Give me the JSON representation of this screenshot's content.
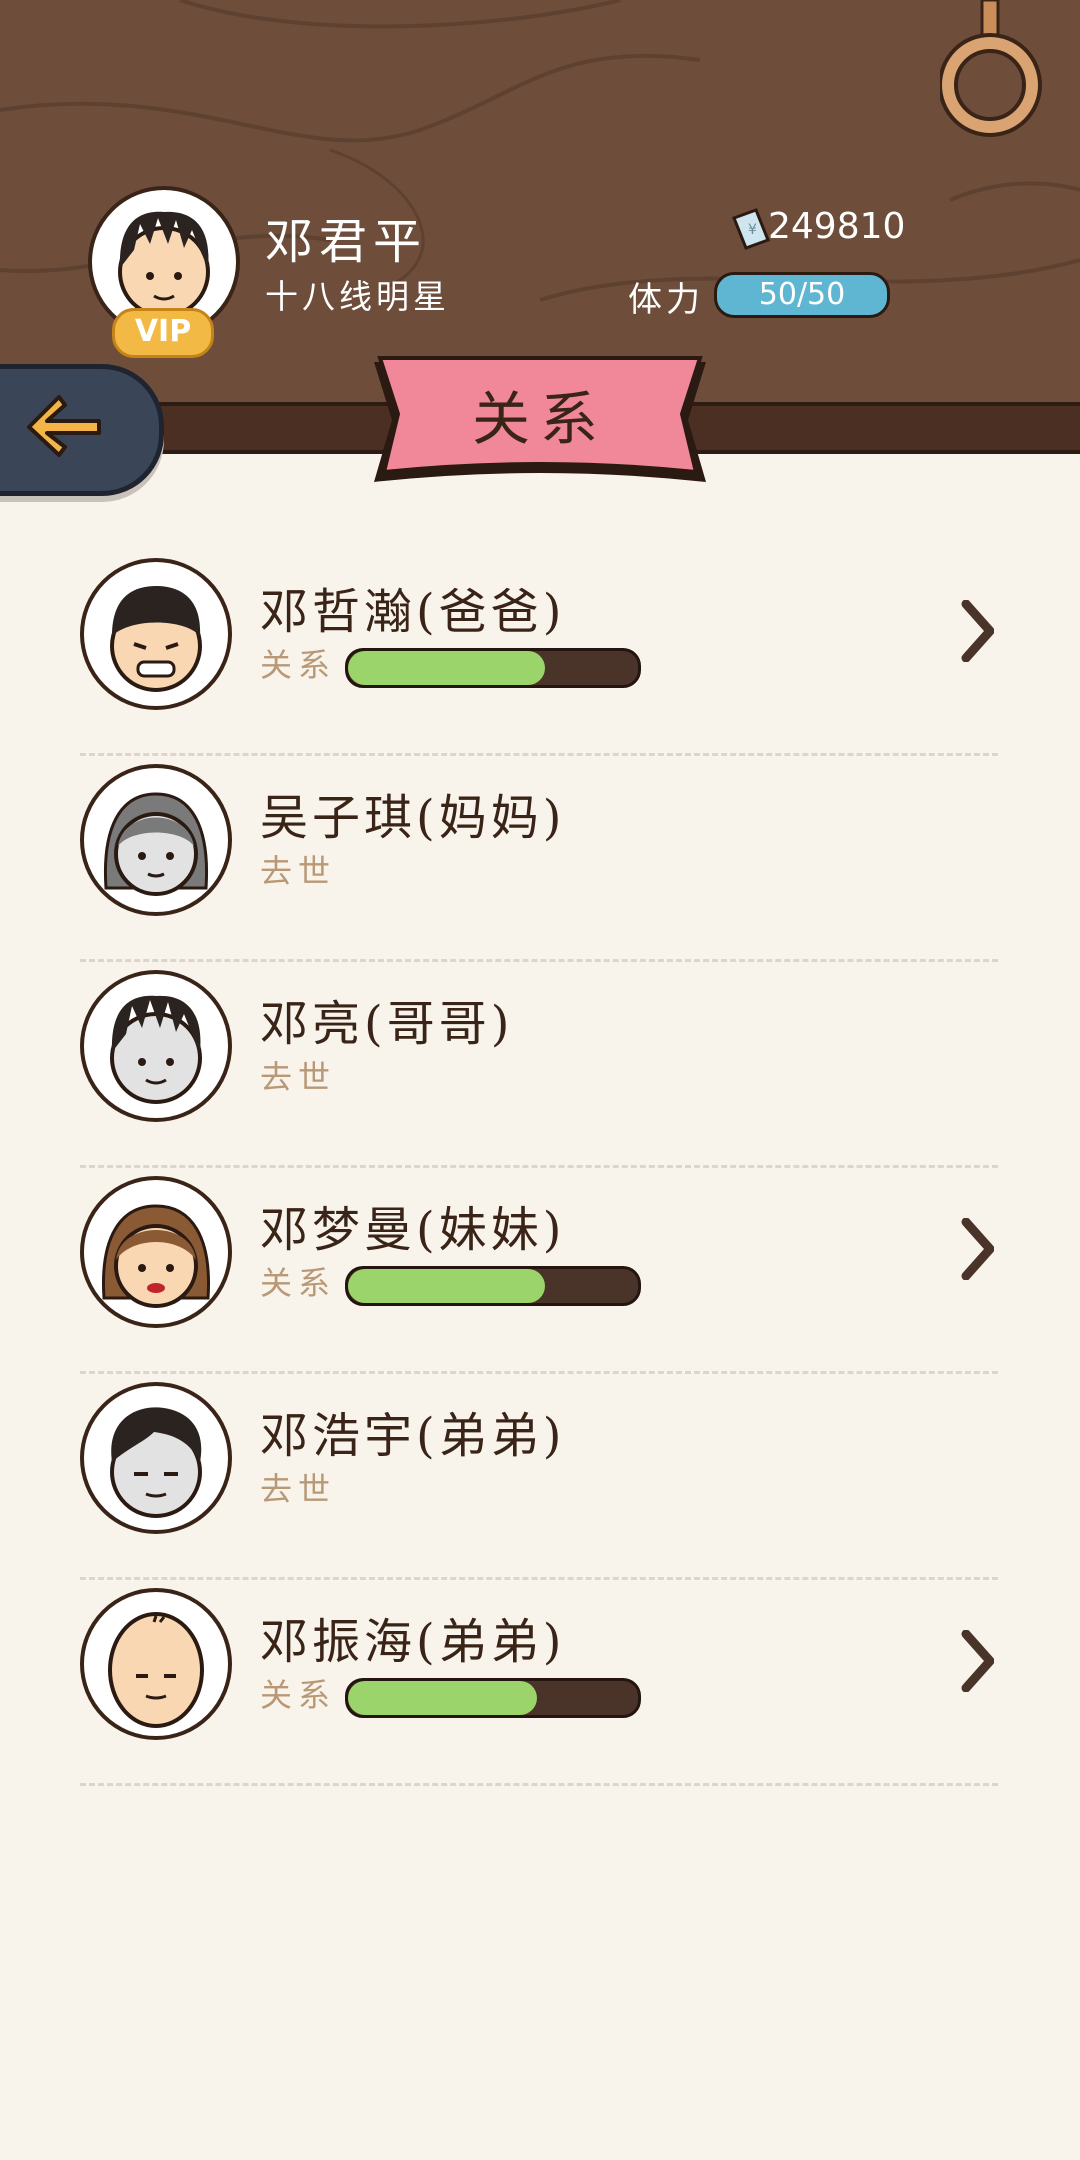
{
  "header": {
    "player_name": "邓君平",
    "player_title": "十八线明星",
    "vip_label": "VIP",
    "money": "249810",
    "stamina_label": "体力",
    "stamina_value": "50/50",
    "stamina_fraction": 1.0,
    "page_title": "关系"
  },
  "colors": {
    "wood": "#6e4e3b",
    "banner": "#f0889a",
    "bar_fill": "#9ad46a",
    "stamina": "#5fb6d2",
    "muted_text": "#b99876"
  },
  "relations": [
    {
      "name": "邓哲瀚(爸爸)",
      "status": "关系",
      "progress": 0.68,
      "alive": true,
      "avatar": "father-face"
    },
    {
      "name": "吴子琪(妈妈)",
      "status": "去世",
      "alive": false,
      "avatar": "mother-face"
    },
    {
      "name": "邓亮(哥哥)",
      "status": "去世",
      "alive": false,
      "avatar": "older-brother-face"
    },
    {
      "name": "邓梦曼(妹妹)",
      "status": "关系",
      "progress": 0.68,
      "alive": true,
      "avatar": "sister-face"
    },
    {
      "name": "邓浩宇(弟弟)",
      "status": "去世",
      "alive": false,
      "avatar": "younger-brother-face"
    },
    {
      "name": "邓振海(弟弟)",
      "status": "关系",
      "progress": 0.65,
      "alive": true,
      "avatar": "baby-brother-face"
    }
  ]
}
